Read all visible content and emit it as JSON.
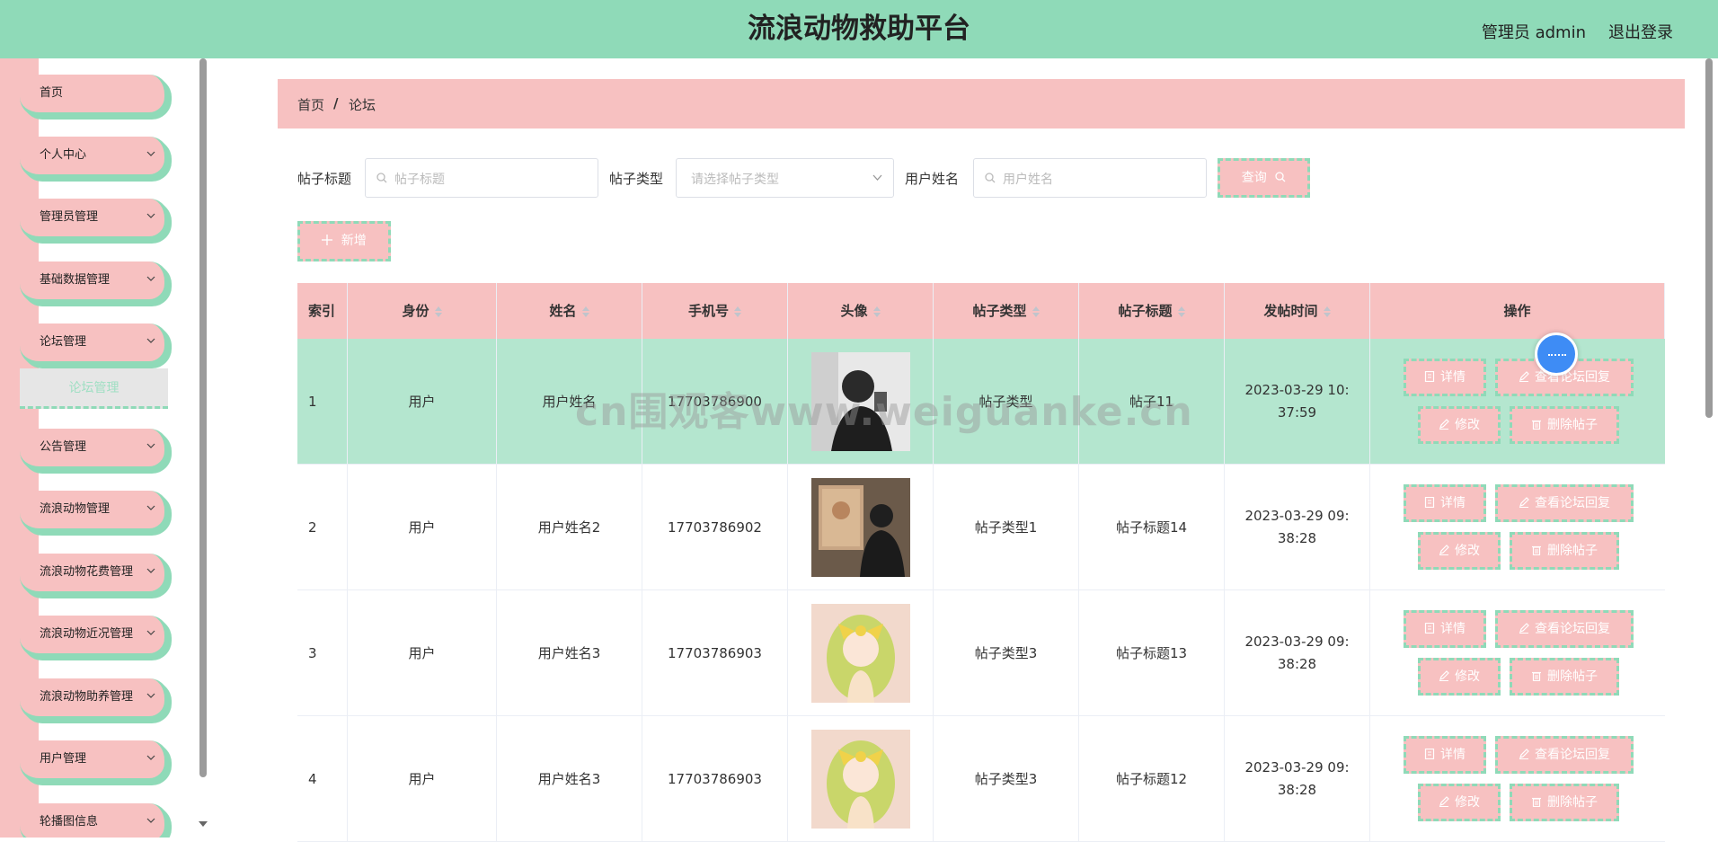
{
  "header": {
    "title": "流浪动物救助平台",
    "user": "管理员 admin",
    "logout": "退出登录"
  },
  "sidebar": {
    "items": [
      {
        "label": "首页",
        "expandable": false
      },
      {
        "label": "个人中心",
        "expandable": true
      },
      {
        "label": "管理员管理",
        "expandable": true
      },
      {
        "label": "基础数据管理",
        "expandable": true
      },
      {
        "label": "论坛管理",
        "expandable": true
      },
      {
        "label": "公告管理",
        "expandable": true
      },
      {
        "label": "流浪动物管理",
        "expandable": true
      },
      {
        "label": "流浪动物花费管理",
        "expandable": true
      },
      {
        "label": "流浪动物近况管理",
        "expandable": true
      },
      {
        "label": "流浪动物助养管理",
        "expandable": true
      },
      {
        "label": "用户管理",
        "expandable": true
      },
      {
        "label": "轮播图信息",
        "expandable": true
      }
    ],
    "submenu_active": "论坛管理"
  },
  "breadcrumb": {
    "home": "首页",
    "separator": "/",
    "current": "论坛"
  },
  "filters": {
    "title_label": "帖子标题",
    "title_placeholder": "帖子标题",
    "type_label": "帖子类型",
    "type_placeholder": "请选择帖子类型",
    "username_label": "用户姓名",
    "username_placeholder": "用户姓名",
    "search_button": "查询",
    "add_button": "新增"
  },
  "table": {
    "columns": [
      "索引",
      "身份",
      "姓名",
      "手机号",
      "头像",
      "帖子类型",
      "帖子标题",
      "发帖时间",
      "操作"
    ],
    "rows": [
      {
        "index": "1",
        "role": "用户",
        "name": "用户姓名",
        "phone": "17703786900",
        "type": "帖子类型",
        "title": "帖子11",
        "time": "2023-03-29 10:37:59",
        "avatar": "bw"
      },
      {
        "index": "2",
        "role": "用户",
        "name": "用户姓名2",
        "phone": "17703786902",
        "type": "帖子类型1",
        "title": "帖子标题14",
        "time": "2023-03-29 09:38:28",
        "avatar": "painting"
      },
      {
        "index": "3",
        "role": "用户",
        "name": "用户姓名3",
        "phone": "17703786903",
        "type": "帖子类型3",
        "title": "帖子标题13",
        "time": "2023-03-29 09:38:28",
        "avatar": "anime"
      },
      {
        "index": "4",
        "role": "用户",
        "name": "用户姓名3",
        "phone": "17703786903",
        "type": "帖子类型3",
        "title": "帖子标题12",
        "time": "2023-03-29 09:38:28",
        "avatar": "anime"
      }
    ],
    "actions": {
      "detail": "详情",
      "view_reply": "查看论坛回复",
      "edit": "修改",
      "delete": "删除帖子"
    }
  },
  "watermark": "cn围观客www.weiguanke.cn",
  "colors": {
    "header": "#8fdab8",
    "pink": "#f7c1c1",
    "highlight_row": "#b4e6cf"
  }
}
